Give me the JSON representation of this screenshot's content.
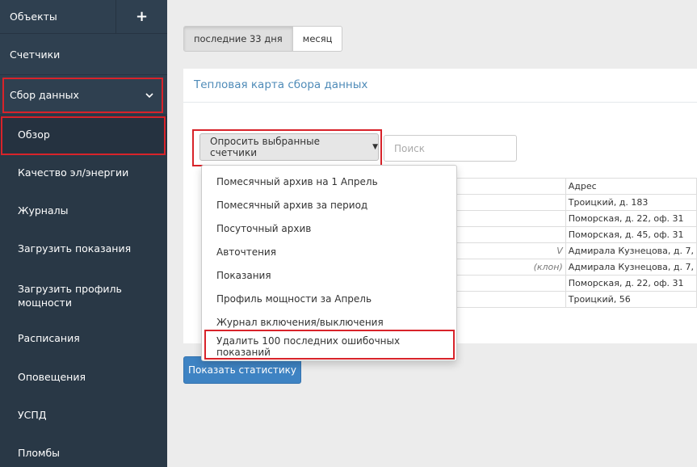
{
  "sidebar": {
    "objects_label": "Объекты",
    "plus_symbol": "+",
    "counters_label": "Счетчики",
    "data_collection_label": "Сбор данных",
    "chevron_symbol": "⌄",
    "sub_items": [
      "Обзор",
      "Качество эл/энергии",
      "Журналы",
      "Загрузить показания",
      "Загрузить профиль мощности",
      "Расписания",
      "Оповещения",
      "УСПД",
      "Пломбы"
    ]
  },
  "period": {
    "last_days_label": "последние 33 дня",
    "month_label": "месяц"
  },
  "panel": {
    "title": "Тепловая карта сбора данных"
  },
  "query_button": {
    "label": "Опросить выбранные счетчики",
    "caret": "▼"
  },
  "search": {
    "placeholder": "Поиск"
  },
  "dropdown": {
    "items": [
      "Помесячный архив на 1 Апрель",
      "Помесячный архив за период",
      "Посуточный архив",
      "Авточтения",
      "Показания",
      "Профиль мощности за Апрель",
      "Журнал включения/выключения",
      "Удалить 100 последних ошибочных показаний"
    ]
  },
  "table": {
    "rows": [
      {
        "name": "",
        "address": "Адрес"
      },
      {
        "name": "",
        "address": "Троицкий, д. 183"
      },
      {
        "name": "",
        "address": "Поморская, д. 22, оф. 31"
      },
      {
        "name": "",
        "address": "Поморская, д. 45, оф. 31"
      },
      {
        "name": "V",
        "address": "Адмирала Кузнецова, д. 7,"
      },
      {
        "name": "(клон)",
        "address": "Адмирала Кузнецова, д. 7,"
      },
      {
        "name": "",
        "address": "Поморская, д. 22, оф. 31"
      },
      {
        "name": "",
        "address": "Троицкий, 56"
      }
    ]
  },
  "stats_button": {
    "label": "Показать статистику"
  },
  "colors": {
    "sidebar_bg": "#2f4050",
    "highlight_red": "#d8232a",
    "primary_blue": "#3e83c3",
    "title_blue": "#4f8bb8"
  }
}
